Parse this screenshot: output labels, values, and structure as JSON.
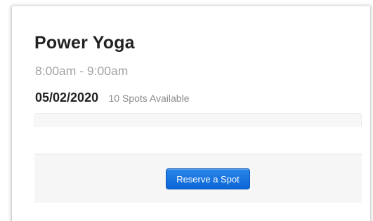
{
  "class_card": {
    "title": "Power Yoga",
    "time": "8:00am - 9:00am",
    "date": "05/02/2020",
    "spots_available": "10 Spots Available",
    "capacity_fill_fraction": 0
  },
  "actions": {
    "reserve_label": "Reserve a Spot"
  },
  "colors": {
    "button_primary": "#0b66d6",
    "title_text": "#222222",
    "muted_text": "#a3a3a3",
    "footer_bg": "#f6f6f6"
  }
}
